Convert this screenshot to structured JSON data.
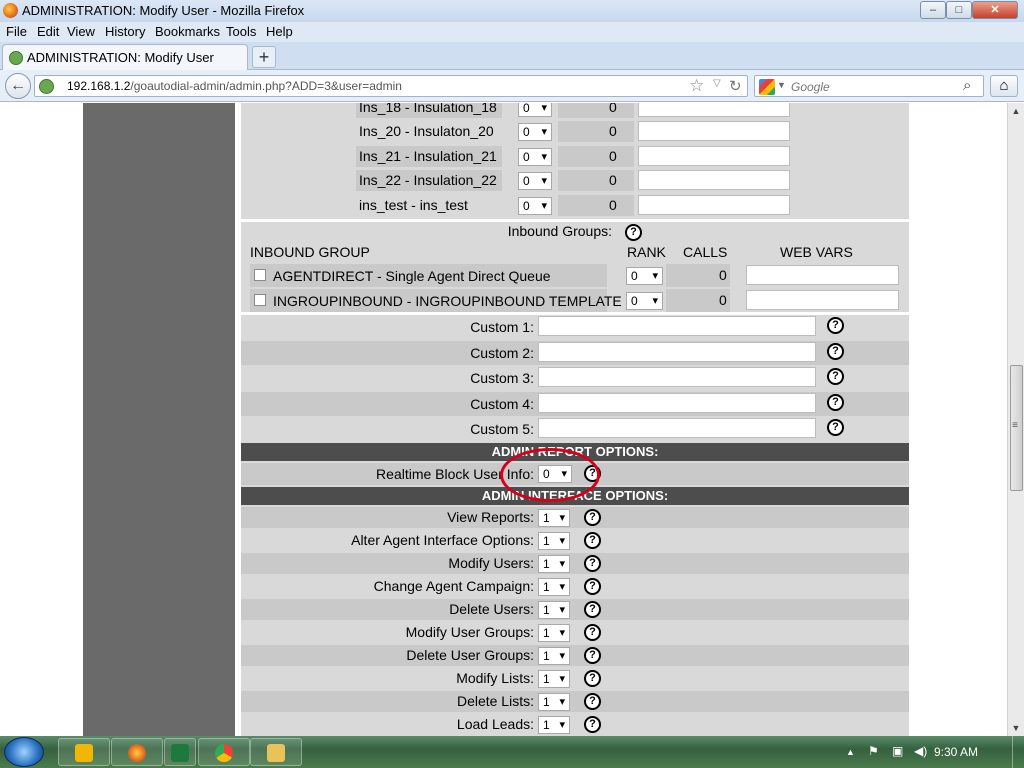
{
  "window": {
    "title": "ADMINISTRATION: Modify User - Mozilla Firefox",
    "minimize": "–",
    "maximize": "□",
    "close": "✕"
  },
  "menu": [
    "File",
    "Edit",
    "View",
    "History",
    "Bookmarks",
    "Tools",
    "Help"
  ],
  "tab": {
    "label": "ADMINISTRATION: Modify User",
    "new_tab": "+"
  },
  "nav": {
    "back": "←",
    "url_host": "192.168.1.2",
    "url_path": "/goautodial-admin/admin.php?ADD=3&user=admin",
    "star": "☆",
    "dropdown": "▽",
    "reload": "↻",
    "search_placeholder": "Google",
    "search_drop": "▼",
    "search_icon": "⌕",
    "home": "⌂"
  },
  "ingroups": [
    {
      "label": "Ins_18 - Insulation_18",
      "select": "0",
      "value": "0"
    },
    {
      "label": "Ins_20 - Insulaton_20",
      "select": "0",
      "value": "0"
    },
    {
      "label": "Ins_21 - Insulation_21",
      "select": "0",
      "value": "0"
    },
    {
      "label": "Ins_22 - Insulation_22",
      "select": "0",
      "value": "0"
    },
    {
      "label": "ins_test - ins_test",
      "select": "0",
      "value": "0"
    }
  ],
  "inbound": {
    "title": "Inbound Groups:",
    "help": "?",
    "col_group": "INBOUND GROUP",
    "col_rank": "RANK",
    "col_calls": "CALLS",
    "col_webvars": "WEB VARS",
    "rows": [
      {
        "label": "AGENTDIRECT - Single Agent Direct Queue",
        "rank": "0",
        "calls": "0"
      },
      {
        "label": "INGROUPINBOUND - INGROUPINBOUND TEMPLATE",
        "rank": "0",
        "calls": "0"
      }
    ]
  },
  "custom": [
    {
      "label": "Custom 1:",
      "help": "?"
    },
    {
      "label": "Custom 2:",
      "help": "?"
    },
    {
      "label": "Custom 3:",
      "help": "?"
    },
    {
      "label": "Custom 4:",
      "help": "?"
    },
    {
      "label": "Custom 5:",
      "help": "?"
    }
  ],
  "report_options": {
    "header": "ADMIN REPORT OPTIONS:",
    "label": "Realtime Block User Info:",
    "value": "0",
    "help": "?"
  },
  "interface_options": {
    "header": "ADMIN INTERFACE OPTIONS:",
    "rows": [
      {
        "label": "View Reports:",
        "value": "1",
        "help": "?"
      },
      {
        "label": "Alter Agent Interface Options:",
        "value": "1",
        "help": "?"
      },
      {
        "label": "Modify Users:",
        "value": "1",
        "help": "?"
      },
      {
        "label": "Change Agent Campaign:",
        "value": "1",
        "help": "?"
      },
      {
        "label": "Delete Users:",
        "value": "1",
        "help": "?"
      },
      {
        "label": "Modify User Groups:",
        "value": "1",
        "help": "?"
      },
      {
        "label": "Delete User Groups:",
        "value": "1",
        "help": "?"
      },
      {
        "label": "Modify Lists:",
        "value": "1",
        "help": "?"
      },
      {
        "label": "Delete Lists:",
        "value": "1",
        "help": "?"
      },
      {
        "label": "Load Leads:",
        "value": "1",
        "help": "?"
      }
    ]
  },
  "scrollbar": {
    "up": "▲",
    "down": "▼",
    "grip": "≡",
    "position": 0.45
  },
  "taskbar": {
    "apps": [
      "outlook-icon",
      "firefox-icon",
      "excel-icon",
      "chrome-icon",
      "explorer-icon"
    ],
    "tray_up": "▲",
    "tray_flag": "⚑",
    "tray_net": "▣",
    "tray_vol": "◀)",
    "clock": "9:30 AM"
  },
  "colors": {
    "annotation_circle": "#d6001c",
    "section_header": "#4d4d4d"
  }
}
